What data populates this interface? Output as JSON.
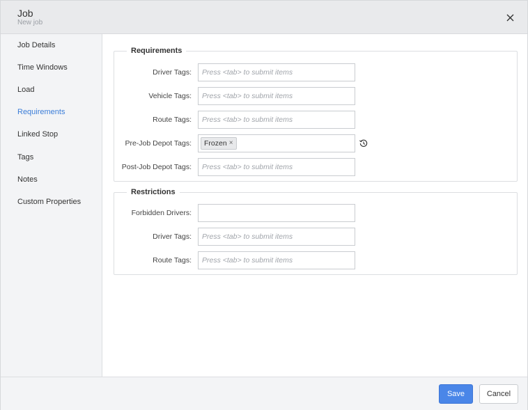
{
  "header": {
    "title": "Job",
    "subtitle": "New job"
  },
  "sidebar": {
    "items": [
      {
        "label": "Job Details"
      },
      {
        "label": "Time Windows"
      },
      {
        "label": "Load"
      },
      {
        "label": "Requirements",
        "active": true
      },
      {
        "label": "Linked Stop"
      },
      {
        "label": "Tags"
      },
      {
        "label": "Notes"
      },
      {
        "label": "Custom Properties"
      }
    ]
  },
  "requirements": {
    "legend": "Requirements",
    "fields": [
      {
        "label": "Driver Tags:",
        "placeholder": "Press <tab> to submit items"
      },
      {
        "label": "Vehicle Tags:",
        "placeholder": "Press <tab> to submit items"
      },
      {
        "label": "Route Tags:",
        "placeholder": "Press <tab> to submit items"
      },
      {
        "label": "Pre-Job Depot Tags:",
        "tags": [
          "Frozen"
        ],
        "tag_remove": "×"
      },
      {
        "label": "Post-Job Depot Tags:",
        "placeholder": "Press <tab> to submit items"
      }
    ]
  },
  "restrictions": {
    "legend": "Restrictions",
    "fields": [
      {
        "label": "Forbidden Drivers:",
        "placeholder": ""
      },
      {
        "label": "Driver Tags:",
        "placeholder": "Press <tab> to submit items"
      },
      {
        "label": "Route Tags:",
        "placeholder": "Press <tab> to submit items"
      }
    ]
  },
  "footer": {
    "save_label": "Save",
    "cancel_label": "Cancel"
  },
  "colors": {
    "accent": "#4a86e8",
    "active_nav": "#3b7dd8"
  }
}
